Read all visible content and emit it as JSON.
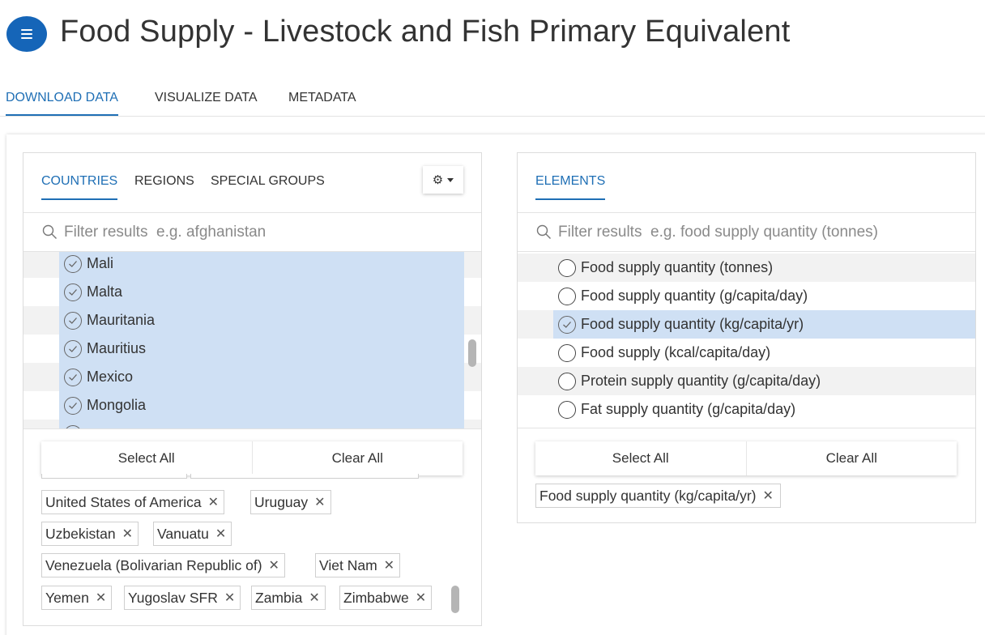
{
  "header": {
    "title": "Food Supply - Livestock and Fish Primary Equivalent",
    "menu_icon": "hamburger-menu-icon"
  },
  "main_tabs": [
    {
      "label": "DOWNLOAD DATA",
      "active": true
    },
    {
      "label": "VISUALIZE DATA",
      "active": false
    },
    {
      "label": "METADATA",
      "active": false
    }
  ],
  "countries_panel": {
    "tabs": [
      {
        "label": "COUNTRIES",
        "active": true
      },
      {
        "label": "REGIONS",
        "active": false
      },
      {
        "label": "SPECIAL GROUPS",
        "active": false
      }
    ],
    "settings_icon": "gear-icon",
    "filter_placeholder": "Filter results  e.g. afghanistan",
    "items": [
      {
        "label": "Mali",
        "selected": true
      },
      {
        "label": "Malta",
        "selected": true
      },
      {
        "label": "Mauritania",
        "selected": true
      },
      {
        "label": "Mauritius",
        "selected": true
      },
      {
        "label": "Mexico",
        "selected": true
      },
      {
        "label": "Mongolia",
        "selected": true
      }
    ],
    "select_all": "Select All",
    "clear_all": "Clear All",
    "selected_chips": [
      "United States of America",
      "Uruguay",
      "Uzbekistan",
      "Vanuatu",
      "Venezuela (Bolivarian Republic of)",
      "Viet Nam",
      "Yemen",
      "Yugoslav SFR",
      "Zambia",
      "Zimbabwe"
    ]
  },
  "elements_panel": {
    "tabs": [
      {
        "label": "ELEMENTS",
        "active": true
      }
    ],
    "filter_placeholder": "Filter results  e.g. food supply quantity (tonnes)",
    "items": [
      {
        "label": "Food supply quantity (tonnes)",
        "selected": false
      },
      {
        "label": "Food supply quantity (g/capita/day)",
        "selected": false
      },
      {
        "label": "Food supply quantity (kg/capita/yr)",
        "selected": true
      },
      {
        "label": "Food supply (kcal/capita/day)",
        "selected": false
      },
      {
        "label": "Protein supply quantity (g/capita/day)",
        "selected": false
      },
      {
        "label": "Fat supply quantity (g/capita/day)",
        "selected": false
      }
    ],
    "select_all": "Select All",
    "clear_all": "Clear All",
    "selected_chips": [
      "Food supply quantity (kg/capita/yr)"
    ]
  },
  "colors": {
    "accent": "#1f6fb5",
    "menu_button": "#1565b8",
    "selection": "#cfe0f4",
    "stripe": "#f2f2f2"
  }
}
